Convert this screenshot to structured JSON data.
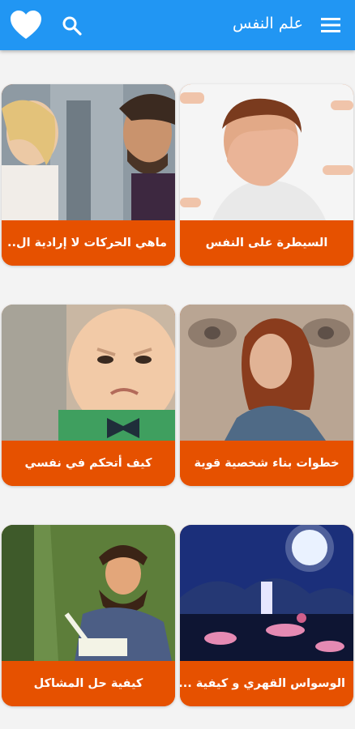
{
  "appbar": {
    "title": "علم النفس",
    "favorites_icon": "heart-icon",
    "search_icon": "search-icon",
    "menu_icon": "menu-icon",
    "color": "#2196f3"
  },
  "cards": [
    {
      "label": "السيطرة على النفس",
      "image": "man-covering-face"
    },
    {
      "label": "ماهي الحركات لا إرادية ال..",
      "image": "couple-talking"
    },
    {
      "label": "خطوات بناء شخصية قوية",
      "image": "woman-with-lion"
    },
    {
      "label": "كيف أتحكم في نفسي",
      "image": "angry-baby"
    },
    {
      "label": "الوسواس القهري و كيفية ...",
      "image": "night-moon-scene"
    },
    {
      "label": "كيفية حل المشاكل",
      "image": "writer-with-quill"
    }
  ],
  "colors": {
    "card_label_bg": "#e65100",
    "background": "#f3f3f3"
  }
}
